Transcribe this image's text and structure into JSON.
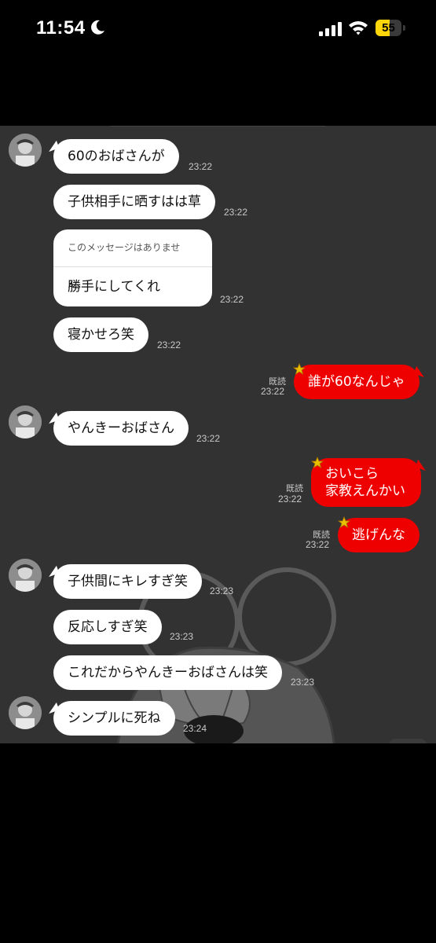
{
  "status_bar": {
    "time": "11:54",
    "battery": "55",
    "battery_level": 0.55,
    "icons": [
      "moon-icon",
      "cellular-signal-icon",
      "wifi-icon",
      "battery-charging-icon"
    ]
  },
  "chat": {
    "background_color": "#323232",
    "incoming_bubble_color": "#ffffff",
    "outgoing_bubble_color": "#ee0000",
    "messages": [
      {
        "side": "in",
        "text": "60のおばさんが",
        "time": "23:22"
      },
      {
        "side": "in",
        "text": "子供相手に晒すはは草",
        "time": "23:22"
      },
      {
        "side": "in",
        "deleted_notice": "このメッセージはありません。",
        "text": "勝手にしてくれ",
        "time": "23:22"
      },
      {
        "side": "in",
        "text": "寝かせろ笑",
        "time": "23:22"
      },
      {
        "side": "out",
        "read": "既読",
        "text": "誰が60なんじゃ",
        "time": "23:22"
      },
      {
        "side": "in",
        "text": "やんきーおばさん",
        "time": "23:22"
      },
      {
        "side": "out",
        "read": "既読",
        "text_lines": [
          "おいこら",
          "家教えんかい"
        ],
        "time": "23:22"
      },
      {
        "side": "out",
        "read": "既読",
        "text": "逃げんな",
        "time": "23:22"
      },
      {
        "side": "in",
        "text": "子供間にキレすぎ笑",
        "time": "23:23"
      },
      {
        "side": "in",
        "text": "反応しすぎ笑",
        "time": "23:23"
      },
      {
        "side": "in",
        "text": "これだからやんきーおばさんは笑",
        "time": "23:23"
      },
      {
        "side": "in",
        "text": "シンプルに死ね",
        "time": "23:24"
      }
    ]
  }
}
